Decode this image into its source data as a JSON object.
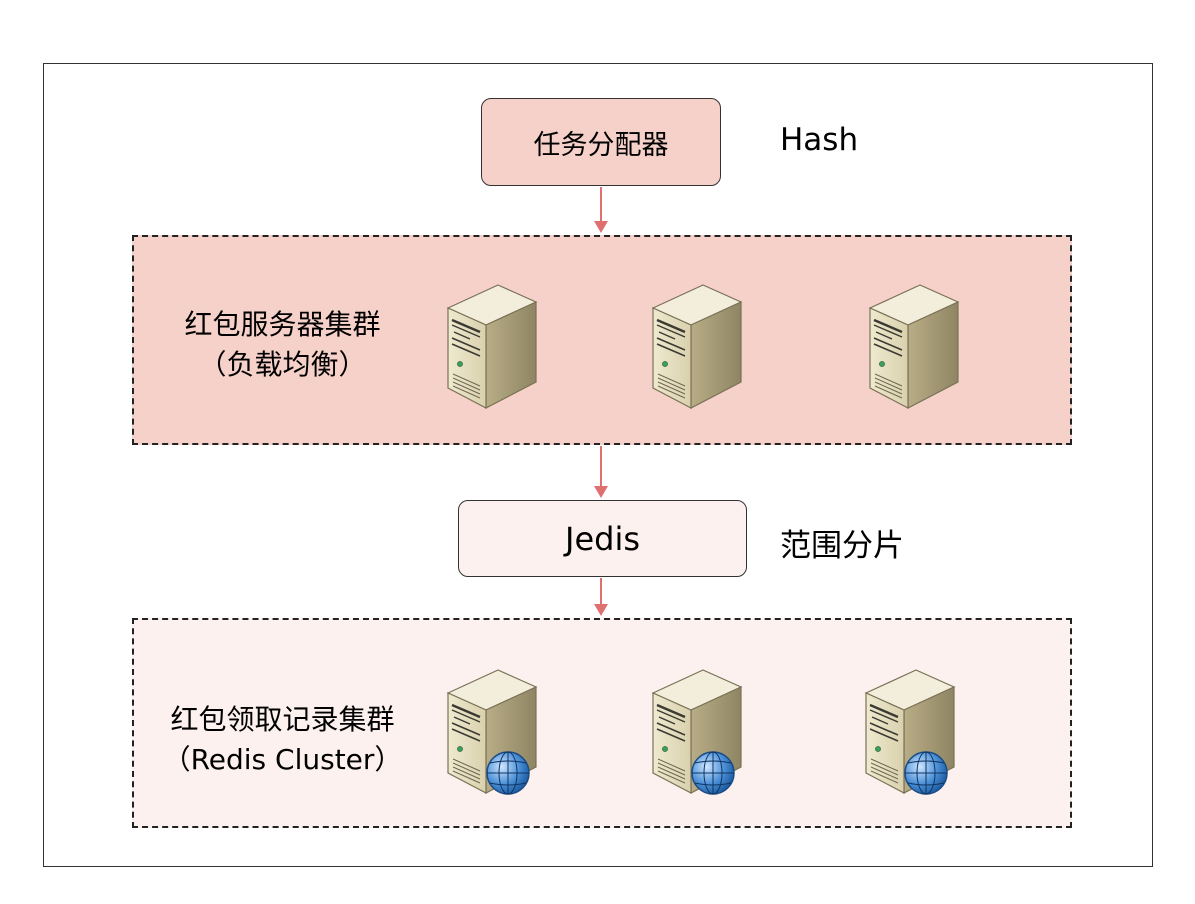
{
  "colors": {
    "top_box_fill": "#f6d1c9",
    "top_cluster_fill": "#f6d1c9",
    "jedis_box_fill": "#fcf1ef",
    "bottom_cluster_fill": "#fcf1ef",
    "arrow": "#e07070",
    "border": "#222222"
  },
  "dispatcher": {
    "label": "任务分配器",
    "annotation": "Hash"
  },
  "service_cluster": {
    "title_line1": "红包服务器集群",
    "title_line2": "（负载均衡）",
    "server_icons": [
      "server-icon",
      "server-icon",
      "server-icon"
    ]
  },
  "jedis": {
    "label": "Jedis",
    "annotation": "范围分片"
  },
  "redis_cluster": {
    "title_line1": "红包领取记录集群",
    "title_line2": "（Redis Cluster）",
    "server_icons": [
      "web-server-icon",
      "web-server-icon",
      "web-server-icon"
    ]
  }
}
